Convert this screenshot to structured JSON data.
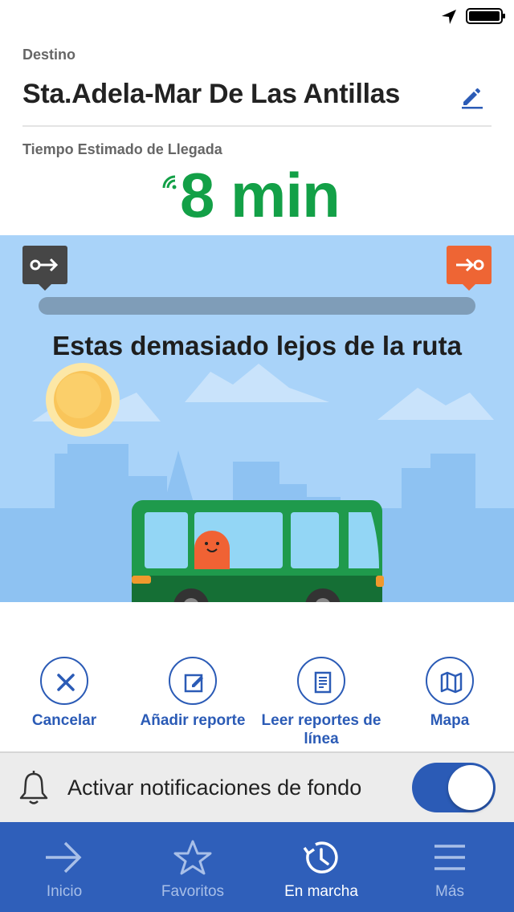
{
  "status_bar": {
    "icons": [
      "location-arrow-icon",
      "battery-icon"
    ]
  },
  "header": {
    "destination_label": "Destino",
    "destination_name": "Sta.Adela-Mar De Las Antillas",
    "eta_label": "Tiempo Estimado de Llegada",
    "eta_value": "8 min",
    "colors": {
      "eta": "#13a047",
      "accent": "#2b5bb6"
    }
  },
  "route": {
    "start_icon": "route-start-icon",
    "end_icon": "route-end-icon",
    "progress": 0,
    "message": "Estas demasiado lejos de la ruta",
    "colors": {
      "sky": "#a9d3f9",
      "bus": "#1f9a4c",
      "start_badge": "#464646",
      "end_badge": "#ee6534"
    }
  },
  "actions": [
    {
      "label": "Cancelar",
      "icon": "close-icon"
    },
    {
      "label": "Añadir reporte",
      "icon": "edit-report-icon"
    },
    {
      "label": "Leer reportes de línea",
      "icon": "document-icon"
    },
    {
      "label": "Mapa",
      "icon": "map-icon"
    }
  ],
  "notifications": {
    "label": "Activar notificaciones de fondo",
    "enabled": true
  },
  "tabbar": {
    "tabs": [
      {
        "label": "Inicio",
        "icon": "arrow-right-icon",
        "active": false
      },
      {
        "label": "Favoritos",
        "icon": "star-icon",
        "active": false
      },
      {
        "label": "En marcha",
        "icon": "clock-arrow-icon",
        "active": true
      },
      {
        "label": "Más",
        "icon": "menu-icon",
        "active": false
      }
    ]
  }
}
